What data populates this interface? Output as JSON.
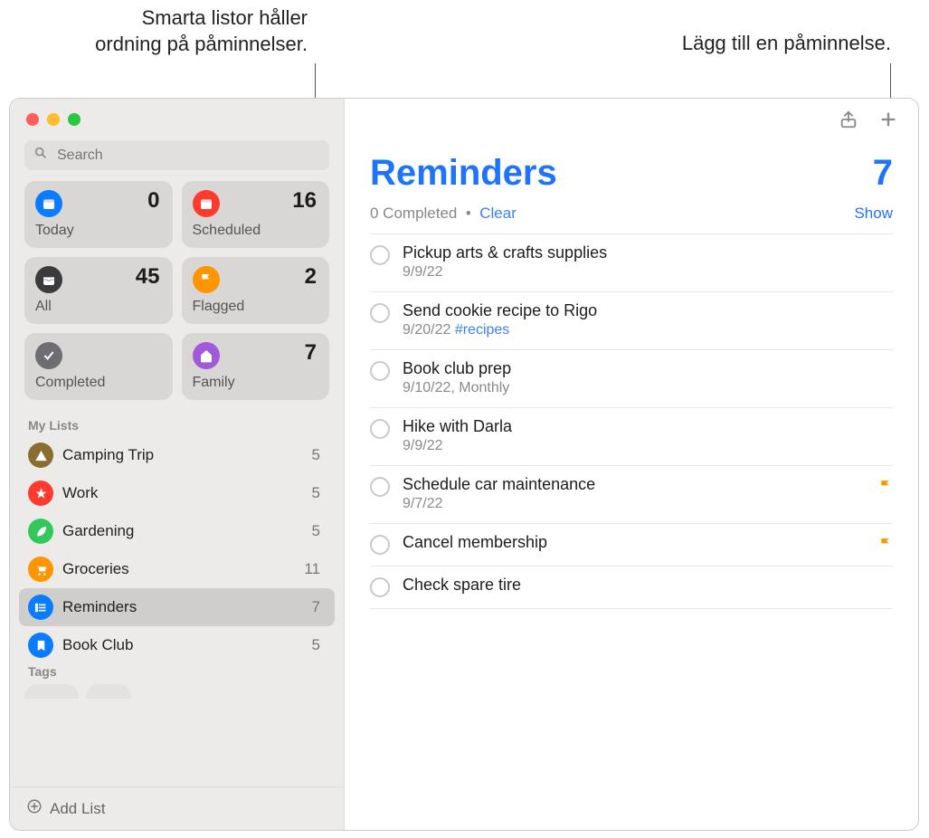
{
  "callouts": {
    "left_line1": "Smarta listor håller",
    "left_line2": "ordning på påminnelser.",
    "right": "Lägg till en påminnelse."
  },
  "search": {
    "placeholder": "Search"
  },
  "cards": [
    {
      "label": "Today",
      "count": "0",
      "color": "#0a7cff",
      "icon": "calendar"
    },
    {
      "label": "Scheduled",
      "count": "16",
      "color": "#ff3b30",
      "icon": "calendar"
    },
    {
      "label": "All",
      "count": "45",
      "color": "#3b3b3d",
      "icon": "tray"
    },
    {
      "label": "Flagged",
      "count": "2",
      "color": "#ff9500",
      "icon": "flag"
    },
    {
      "label": "Completed",
      "count": "",
      "color": "#6d6d72",
      "icon": "check"
    },
    {
      "label": "Family",
      "count": "7",
      "color": "#a259d9",
      "icon": "house"
    }
  ],
  "my_lists_header": "My Lists",
  "lists": [
    {
      "name": "Camping Trip",
      "count": "5",
      "color": "#8a6d2f",
      "icon": "tent"
    },
    {
      "name": "Work",
      "count": "5",
      "color": "#ff3b30",
      "icon": "star"
    },
    {
      "name": "Gardening",
      "count": "5",
      "color": "#34c759",
      "icon": "leaf"
    },
    {
      "name": "Groceries",
      "count": "11",
      "color": "#ff9500",
      "icon": "cart"
    },
    {
      "name": "Reminders",
      "count": "7",
      "color": "#0a7cff",
      "icon": "list",
      "selected": true
    },
    {
      "name": "Book Club",
      "count": "5",
      "color": "#0a7cff",
      "icon": "bookmark"
    }
  ],
  "tags_header": "Tags",
  "add_list_label": "Add List",
  "main": {
    "title": "Reminders",
    "count": "7",
    "completed_text": "0 Completed",
    "dot": "•",
    "clear": "Clear",
    "show": "Show"
  },
  "items": [
    {
      "title": "Pickup arts & crafts supplies",
      "sub": "9/9/22"
    },
    {
      "title": "Send cookie recipe to Rigo",
      "sub": "9/20/22 ",
      "tag": "#recipes"
    },
    {
      "title": "Book club prep",
      "sub": "9/10/22, Monthly"
    },
    {
      "title": "Hike with Darla",
      "sub": "9/9/22"
    },
    {
      "title": "Schedule car maintenance",
      "sub": "9/7/22",
      "flagged": true
    },
    {
      "title": "Cancel membership",
      "sub": "",
      "flagged": true
    },
    {
      "title": "Check spare tire",
      "sub": ""
    }
  ]
}
